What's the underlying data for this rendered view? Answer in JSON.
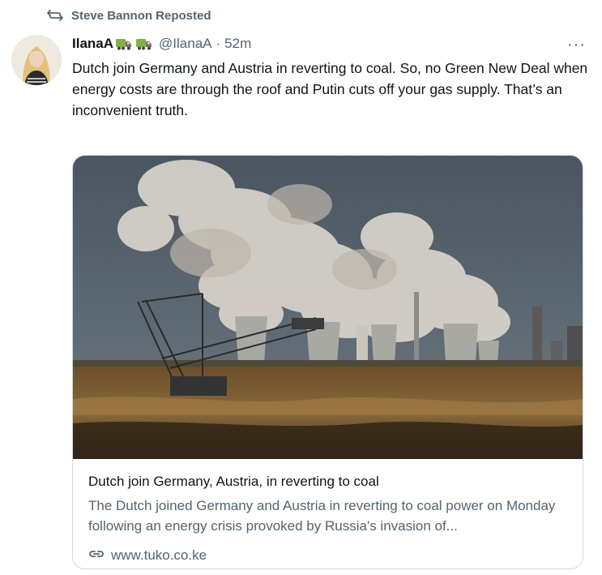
{
  "repost": {
    "label": "Steve Bannon Reposted",
    "icon": "repost-icon"
  },
  "tweet": {
    "author_name": "IlanaA",
    "author_emoji": [
      "truck-emoji",
      "truck-emoji"
    ],
    "handle": "@IlanaA",
    "separator": "·",
    "time": "52m",
    "more_label": "···",
    "text": "Dutch join Germany and Austria in reverting to coal. So, no Green New Deal when energy costs are through the roof and Putin cuts off your gas supply. That’s an inconvenient truth."
  },
  "card": {
    "title": "Dutch join Germany, Austria, in reverting to coal",
    "description": "The Dutch joined Germany and Austria in reverting to coal power on Monday following an energy crisis provoked by Russia's invasion of...",
    "domain": "www.tuko.co.ke",
    "link_icon": "link-icon"
  },
  "colors": {
    "text_primary": "#0f1419",
    "text_secondary": "#536471",
    "card_border": "#cfd9de"
  }
}
